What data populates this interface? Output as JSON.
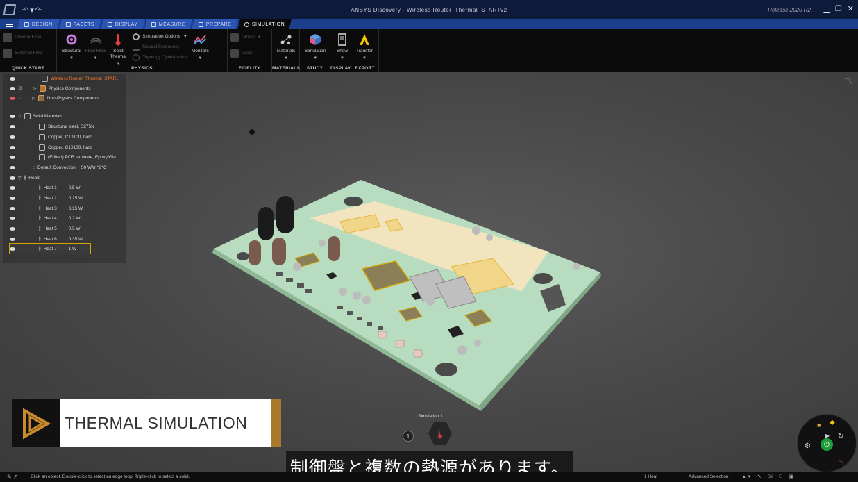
{
  "window": {
    "title": "ANSYS Discovery - Wireless Router_Thermal_STARTv2",
    "release": "Release 2020 R2"
  },
  "tabs": [
    {
      "label": "Design"
    },
    {
      "label": "Facets"
    },
    {
      "label": "Display"
    },
    {
      "label": "Measure"
    },
    {
      "label": "Prepare"
    },
    {
      "label": "Simulation",
      "active": true
    }
  ],
  "ribbon": {
    "quick_start": {
      "label": "Quick Start",
      "internal_flow": "Internal Flow",
      "external_flow": "External Flow"
    },
    "physics": {
      "label": "Physics",
      "structural": "Structural",
      "fluid_flow": "Fluid Flow",
      "solid_thermal_1": "Solid",
      "solid_thermal_2": "Thermal",
      "simulation_options": "Simulation Options",
      "natural_frequency": "Natural Frequency",
      "topology_optimization": "Topology Optimization",
      "monitors": "Monitors"
    },
    "fidelity": {
      "label": "Fidelity",
      "global": "Global",
      "local": "Local"
    },
    "materials": {
      "label": "Materials",
      "button": "Materials"
    },
    "study": {
      "label": "Study",
      "button": "Simulation"
    },
    "display": {
      "label": "Display",
      "button": "Show"
    },
    "export": {
      "label": "Export",
      "button": "Transfer"
    }
  },
  "tree": {
    "root": "Wireless Router_Thermal_STAR...",
    "physics_components": "Physics Components",
    "non_physics_components": "Non-Physics Components",
    "solid_materials": "Solid Materials",
    "materials": [
      "Structural steel, S275N",
      "Copper, C10100, hard",
      "Copper, C10100, hard",
      "(Edited) PCB laminate, Epoxy/Gla..."
    ],
    "default_convection": {
      "label": "Default Convection",
      "value": "50 W/m^2^C"
    },
    "heats_label": "Heats",
    "heats": [
      {
        "label": "Heat 1",
        "value": "0.5 W"
      },
      {
        "label": "Heat 2",
        "value": "0.25 W"
      },
      {
        "label": "Heat 3",
        "value": "0.15 W"
      },
      {
        "label": "Heat 4",
        "value": "0.2 W"
      },
      {
        "label": "Heat 5",
        "value": "0.5 W"
      },
      {
        "label": "Heat 6",
        "value": "0.35 W"
      },
      {
        "label": "Heat 7",
        "value": "1 W",
        "selected": true
      }
    ]
  },
  "viewport": {
    "simulation_label": "Simulation 1",
    "marker_number": "1"
  },
  "overlay": {
    "banner": "THERMAL SIMULATION",
    "subtitle": "制御盤と複数の熱源があります。"
  },
  "status": {
    "hint": "Click an object. Double-click to select an edge loop. Triple-click to select a solid.",
    "selection_count": "1 Heat",
    "selection_mode": "Advanced Selection"
  },
  "colors": {
    "accent_tab": "#1c3f8c",
    "selection_outline": "#d6a400",
    "pcb_green": "#c4e6c8",
    "banner_bar": "#a87b2c"
  }
}
